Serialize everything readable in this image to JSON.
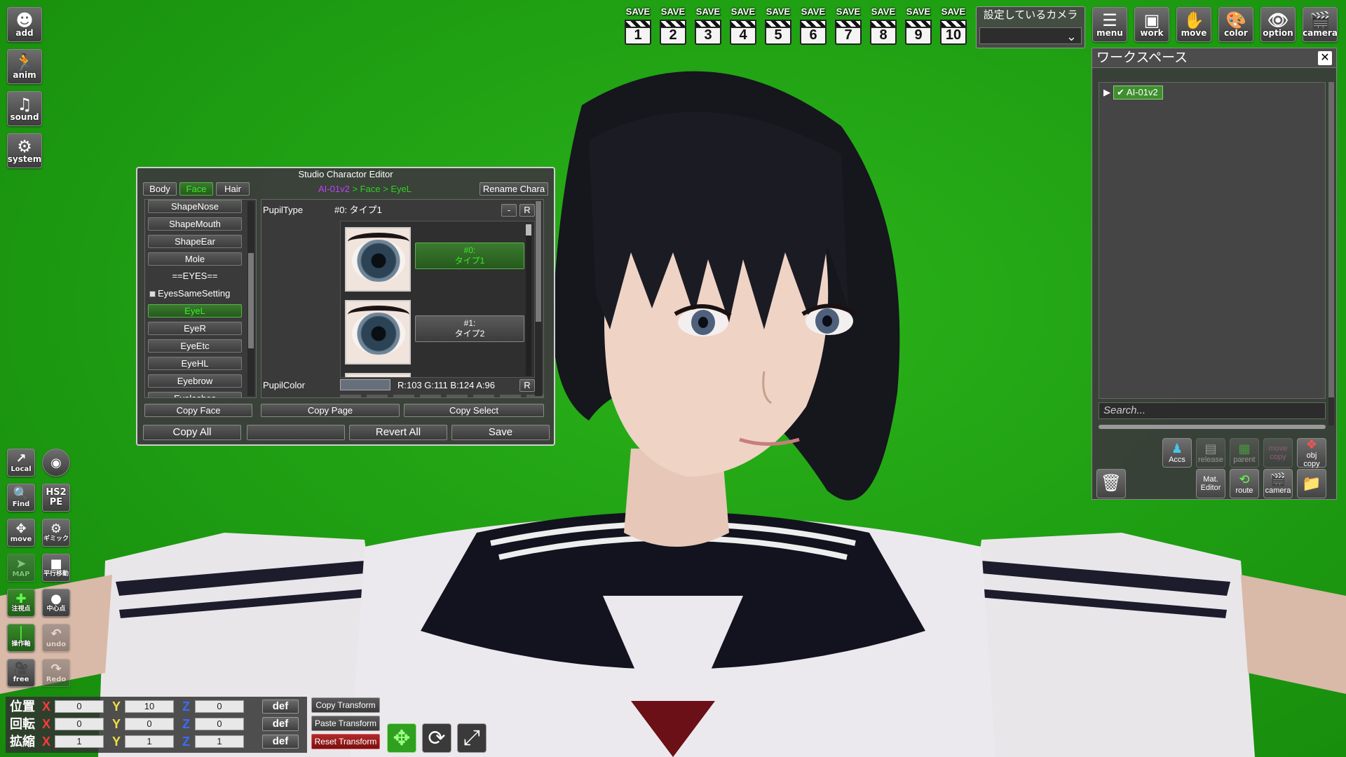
{
  "scene": {
    "background_color": "#1e9d12"
  },
  "left_toolbar": [
    {
      "label": "add",
      "icon": "person-add-icon"
    },
    {
      "label": "anim",
      "icon": "running-figure-icon"
    },
    {
      "label": "sound",
      "icon": "music-note-icon"
    },
    {
      "label": "system",
      "icon": "gears-icon"
    }
  ],
  "left_tools": [
    {
      "label": "Local",
      "icon": "axis-local-icon",
      "state": "normal"
    },
    {
      "label": "",
      "icon": "camera-shutter-icon",
      "state": "normal"
    },
    {
      "label": "Find",
      "icon": "magnifier-icon",
      "state": "normal"
    },
    {
      "label": "HS2 PE",
      "icon": "hs2pe-icon",
      "state": "normal"
    },
    {
      "label": "move",
      "icon": "move-arrows-icon",
      "state": "normal"
    },
    {
      "label": "ギミック",
      "icon": "gimmick-gear-icon",
      "state": "normal"
    },
    {
      "label": "MAP",
      "icon": "map-arrow-icon",
      "state": "dim"
    },
    {
      "label": "平行移動",
      "icon": "parallel-move-icon",
      "state": "normal"
    },
    {
      "label": "注視点",
      "icon": "gaze-point-icon",
      "state": "green"
    },
    {
      "label": "中心点",
      "icon": "center-point-icon",
      "state": "normal"
    },
    {
      "label": "操作軸",
      "icon": "operation-axis-icon",
      "state": "green"
    },
    {
      "label": "undo",
      "icon": "undo-icon",
      "state": "dim"
    },
    {
      "label": "free",
      "icon": "free-camera-icon",
      "state": "normal"
    },
    {
      "label": "Redo",
      "icon": "redo-icon",
      "state": "dim"
    }
  ],
  "save_slots": {
    "label": "SAVE",
    "numbers": [
      "1",
      "2",
      "3",
      "4",
      "5",
      "6",
      "7",
      "8",
      "9",
      "10"
    ]
  },
  "camera_select": {
    "caption": "設定しているカメラ",
    "value": ""
  },
  "top_right_menu": [
    {
      "label": "menu",
      "icon": "list-icon"
    },
    {
      "label": "work",
      "icon": "workspace-icon"
    },
    {
      "label": "move",
      "icon": "hand-icon"
    },
    {
      "label": "color",
      "icon": "palette-icon"
    },
    {
      "label": "option",
      "icon": "eye-icon"
    },
    {
      "label": "camera",
      "icon": "clapper-icon"
    }
  ],
  "workspace": {
    "title": "ワークスペース",
    "tree_item": "AI-01v2",
    "search_placeholder": "Search...",
    "buttons_row1": [
      {
        "label": "Accs",
        "state": "normal"
      },
      {
        "label": "release",
        "state": "dim"
      },
      {
        "label": "parent",
        "state": "dim"
      },
      {
        "label": "move copy",
        "state": "dim"
      },
      {
        "label": "obj copy",
        "state": "normal"
      }
    ],
    "buttons_row2": [
      {
        "label": "Mat. Editor",
        "state": "normal"
      },
      {
        "label": "route",
        "state": "normal"
      },
      {
        "label": "camera",
        "state": "normal"
      },
      {
        "label": "",
        "state": "normal"
      }
    ]
  },
  "editor": {
    "title": "Studio Charactor Editor",
    "tabs": [
      "Body",
      "Face",
      "Hair"
    ],
    "active_tab": "Face",
    "breadcrumb": {
      "chara": "AI-01v2",
      "section": "Face",
      "item": "EyeL",
      "separator": ">"
    },
    "rename_label": "Rename Chara",
    "categories": {
      "shape_nose": "ShapeNose",
      "shape_mouth": "ShapeMouth",
      "shape_ear": "ShapeEar",
      "mole": "Mole",
      "eyes_header": "==EYES==",
      "eyes_same_setting": "EyesSameSetting",
      "eye_l": "EyeL",
      "eye_r": "EyeR",
      "eye_etc": "EyeEtc",
      "eye_hl": "EyeHL",
      "eyebrow": "Eyebrow",
      "eyelashes": "Eyelashes"
    },
    "pupil_type": {
      "label": "PupilType",
      "value": "#0: タイプ1",
      "minus": "-",
      "reset": "R"
    },
    "pupil_options": [
      {
        "line1": "#0:",
        "line2": "タイプ1",
        "selected": true
      },
      {
        "line1": "#1:",
        "line2": "タイプ2",
        "selected": false
      }
    ],
    "pupil_color": {
      "label": "PupilColor",
      "value": "R:103 G:111 B:124 A:96",
      "swatch": "#676f7c",
      "reset": "R"
    },
    "footer_row1": {
      "copy_face": "Copy Face",
      "copy_page": "Copy Page",
      "copy_select": "Copy Select"
    },
    "footer_row2": {
      "copy_all": "Copy All",
      "blank": "",
      "revert_all": "Revert All",
      "save": "Save"
    }
  },
  "transform": {
    "rows": [
      {
        "label": "位置",
        "x": "0",
        "y": "10",
        "z": "0"
      },
      {
        "label": "回転",
        "x": "0",
        "y": "0",
        "z": "0"
      },
      {
        "label": "拡縮",
        "x": "1",
        "y": "1",
        "z": "1"
      }
    ],
    "axis_labels": {
      "x": "X",
      "y": "Y",
      "z": "Z"
    },
    "def_label": "def",
    "copy_label": "Copy Transform",
    "paste_label": "Paste Transform",
    "reset_label": "Reset Transform"
  }
}
